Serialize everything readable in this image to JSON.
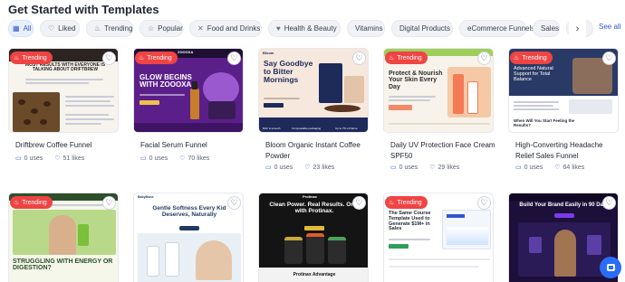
{
  "page": {
    "title": "Get Started with Templates"
  },
  "filters": [
    {
      "label": "All",
      "icon": "grid-icon",
      "active": true
    },
    {
      "label": "Liked",
      "icon": "heart-icon"
    },
    {
      "label": "Trending",
      "icon": "flame-icon"
    },
    {
      "label": "Popular",
      "icon": "star-icon"
    },
    {
      "label": "Food and Drinks",
      "icon": "utensils-icon"
    },
    {
      "label": "Health & Beauty",
      "icon": "heart-pulse-icon"
    },
    {
      "label": "Vitamins"
    },
    {
      "label": "Digital Products"
    },
    {
      "label": "eCommerce Funnels"
    },
    {
      "label": "Sales"
    },
    {
      "label": "D"
    }
  ],
  "see_all": "See all",
  "badge_label": "Trending",
  "cards": [
    {
      "title": "Driftbrew Coffee Funnel",
      "uses": "0 uses",
      "likes": "51 likes",
      "trending": true,
      "thumb": {
        "headline": "MOST RESULTS WITH EVERYONE IS TALKING ABOUT DRIFTBREW"
      }
    },
    {
      "title": "Facial Serum Funnel",
      "uses": "0 uses",
      "likes": "70 likes",
      "trending": true,
      "thumb": {
        "brand": "ZOOOXA",
        "headline": "GLOW BEGINS WITH ZOOOXA"
      }
    },
    {
      "title": "Bloom Organic Instant Coffee Powder",
      "uses": "0 uses",
      "likes": "23 likes",
      "trending": false,
      "thumb": {
        "brand": "Bloom",
        "headline": "Say Goodbye to Bitter Mornings",
        "f1": "Rich & smooth",
        "f2": "Compostable packaging",
        "f3": "Up to 7% of Name"
      }
    },
    {
      "title": "Daily UV Protection Face Cream SPF50",
      "uses": "0 uses",
      "likes": "29 likes",
      "trending": true,
      "thumb": {
        "headline": "Protect & Nourish Your Skin Every Day"
      }
    },
    {
      "title": "High-Converting Headache Relief Sales Funnel",
      "uses": "0 uses",
      "likes": "64 likes",
      "trending": true,
      "thumb": {
        "headline": "Advanced Natural Support for Total Balance",
        "sub": "When Will You Start Feeling the Results?"
      }
    },
    {
      "title": "",
      "trending": true,
      "thumb": {
        "headline": "STRUGGLING WITH ENERGY OR DIGESTION?"
      }
    },
    {
      "title": "",
      "trending": false,
      "thumb": {
        "brand": "BabyBond",
        "headline": "Gentle Softness Every Kid Deserves, Naturally"
      }
    },
    {
      "title": "",
      "trending": false,
      "thumb": {
        "brand": "Protinax",
        "headline": "Clean Power. Real Results. Only with Protinax.",
        "sub": "Protinax Advantage"
      }
    },
    {
      "title": "",
      "trending": true,
      "thumb": {
        "headline": "The Same Course Template Used to Generate $1M+ in Sales"
      }
    },
    {
      "title": "",
      "trending": false,
      "thumb": {
        "headline": "Build Your Brand Easily in 90 Days"
      }
    }
  ]
}
